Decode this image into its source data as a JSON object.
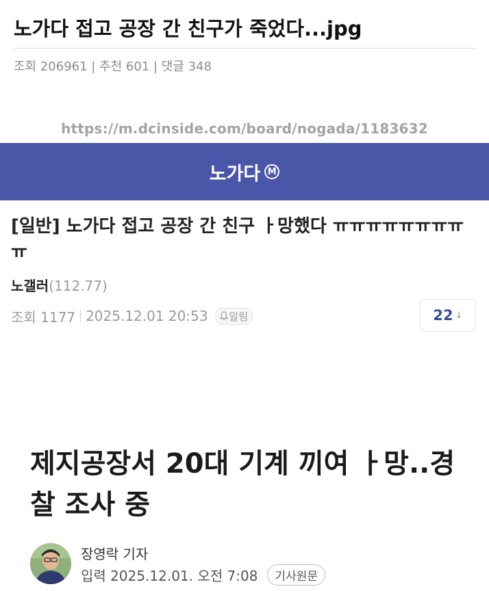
{
  "post": {
    "title": "노가다 접고 공장 간 친구가 죽었다...jpg",
    "meta": "조회 206961 | 추천 601 | 댓글 348"
  },
  "screenshot": {
    "source_url": "https://m.dcinside.com/board/nogada/1183632",
    "gallery": {
      "name": "노가다",
      "badge": "M",
      "bar_color": "#4a56a8"
    },
    "article": {
      "category": "[일반]",
      "title": "노가다 접고 공장 간 친구 ㅏ망했다 ㅠㅠㅠㅠㅠㅠㅠㅠㅠ",
      "author": "노갤러",
      "author_ip": "(112.77)",
      "views": "조회 1177",
      "datetime": "2025.12.01 20:53",
      "alarm_label": "알림",
      "comment_count": "22",
      "comment_arrow": "↓"
    },
    "news": {
      "headline": "제지공장서 20대 기계 끼여 ㅏ망..경찰 조사 중",
      "reporter": "장영락 기자",
      "input_time": "입력 2025.12.01. 오전 7:08",
      "original_button": "기사원문"
    }
  }
}
